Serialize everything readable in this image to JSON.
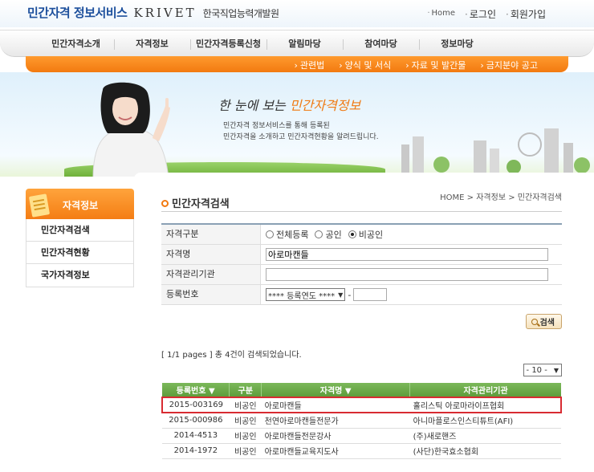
{
  "header": {
    "logo": "민간자격 정보서비스",
    "krivet": "KRIVET",
    "org": "한국직업능력개발원",
    "home": "Home",
    "login": "로그인",
    "join": "회원가입"
  },
  "gnb": [
    "민간자격소개",
    "자격정보",
    "민간자격등록신청",
    "알림마당",
    "참여마당",
    "정보마당"
  ],
  "subnav": [
    "관련법",
    "양식 및 서식",
    "자료 및 발간물",
    "금지분야 공고"
  ],
  "hero": {
    "headline_prefix": "한 눈에 보는",
    "headline_highlight": "민간자격정보",
    "desc_line1": "민간자격 정보서비스를 통해 등록된",
    "desc_line2": "민간자격을 소개하고 민간자격현황을 알려드립니다."
  },
  "lnb": {
    "title": "자격정보",
    "items": [
      "민간자격검색",
      "민간자격현황",
      "국가자격정보"
    ]
  },
  "content": {
    "title": "민간자격검색",
    "breadcrumb": [
      "HOME",
      "자격정보",
      "민간자격검색"
    ]
  },
  "form": {
    "type_label": "자격구분",
    "type_options": [
      "전체등록",
      "공인",
      "비공인"
    ],
    "type_selected": "비공인",
    "name_label": "자격명",
    "name_value": "아로마캔들",
    "org_label": "자격관리기관",
    "org_value": "",
    "reg_label": "등록번호",
    "reg_year_select": "**** 등록연도 ****",
    "reg_dash": "-",
    "reg_number": "",
    "search_button": "검색"
  },
  "result": {
    "info": "[ 1/1 pages ] 총 4건이 검색되었습니다.",
    "page_size": "- 10 -",
    "columns": [
      "등록번호 ▼",
      "구분",
      "자격명 ▼",
      "자격관리기관"
    ],
    "rows": [
      [
        "2015-003169",
        "비공인",
        "아로마캔들",
        "홀리스틱 아로마라이프협회"
      ],
      [
        "2015-000986",
        "비공인",
        "천연아로마캔들전문가",
        "아니마플로스인스티튜트(AFI)"
      ],
      [
        "2014-4513",
        "비공인",
        "아로마캔들전문강사",
        "(주)새로핸즈"
      ],
      [
        "2014-1972",
        "비공인",
        "아로마캔들교육지도사",
        "(사단)한국효소협회"
      ]
    ],
    "highlighted_row": 0
  },
  "colors": {
    "accent_orange": "#f27a10",
    "table_header_green": "#6aa948",
    "highlight_red": "#d82b32",
    "logo_blue": "#1c4f9c"
  }
}
